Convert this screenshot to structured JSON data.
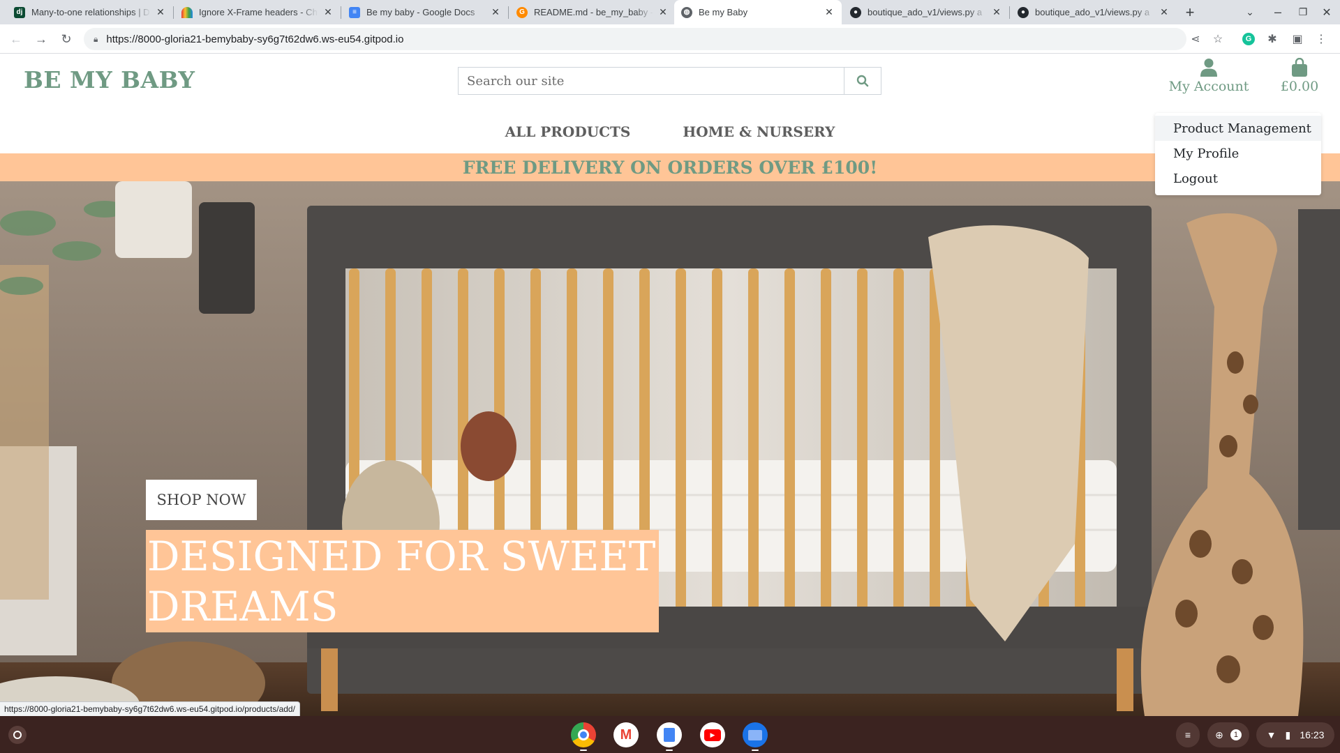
{
  "browser": {
    "tabs": [
      {
        "title": "Many-to-one relationships | D",
        "icon": "django-favicon-icon"
      },
      {
        "title": "Ignore X-Frame headers - Ch",
        "icon": "rainbow-favicon-icon"
      },
      {
        "title": "Be my baby - Google Docs",
        "icon": "google-docs-icon"
      },
      {
        "title": "README.md - be_my_baby -",
        "icon": "gitpod-favicon-icon"
      },
      {
        "title": "Be my Baby",
        "icon": "globe-icon",
        "active": true
      },
      {
        "title": "boutique_ado_v1/views.py a",
        "icon": "github-icon"
      },
      {
        "title": "boutique_ado_v1/views.py a",
        "icon": "github-icon"
      }
    ],
    "url": "https://8000-gloria21-bemybaby-sy6g7t62dw6.ws-eu54.gitpod.io",
    "status_url": "https://8000-gloria21-bemybaby-sy6g7t62dw6.ws-eu54.gitpod.io/products/add/"
  },
  "site": {
    "logo": "BE MY BABY",
    "search_placeholder": "Search our site",
    "account_label": "My Account",
    "bag_total": "£0.00",
    "nav": [
      "ALL PRODUCTS",
      "HOME & NURSERY"
    ],
    "account_menu": [
      "Product Management",
      "My Profile",
      "Logout"
    ],
    "delivery_banner": "FREE DELIVERY ON ORDERS OVER £100!",
    "hero": {
      "title_line1": "DESIGNED FOR SWEET",
      "title_line2": "DREAMS",
      "cta": "SHOP NOW"
    }
  },
  "colors": {
    "brand_green": "#6f9a83",
    "banner_peach": "#ffc597",
    "shelf_bg": "#3b2320"
  },
  "shelf": {
    "apps": [
      "chrome-icon",
      "gmail-icon",
      "google-docs-icon",
      "youtube-icon",
      "files-icon"
    ],
    "notification_count": "1",
    "time": "16:23"
  }
}
